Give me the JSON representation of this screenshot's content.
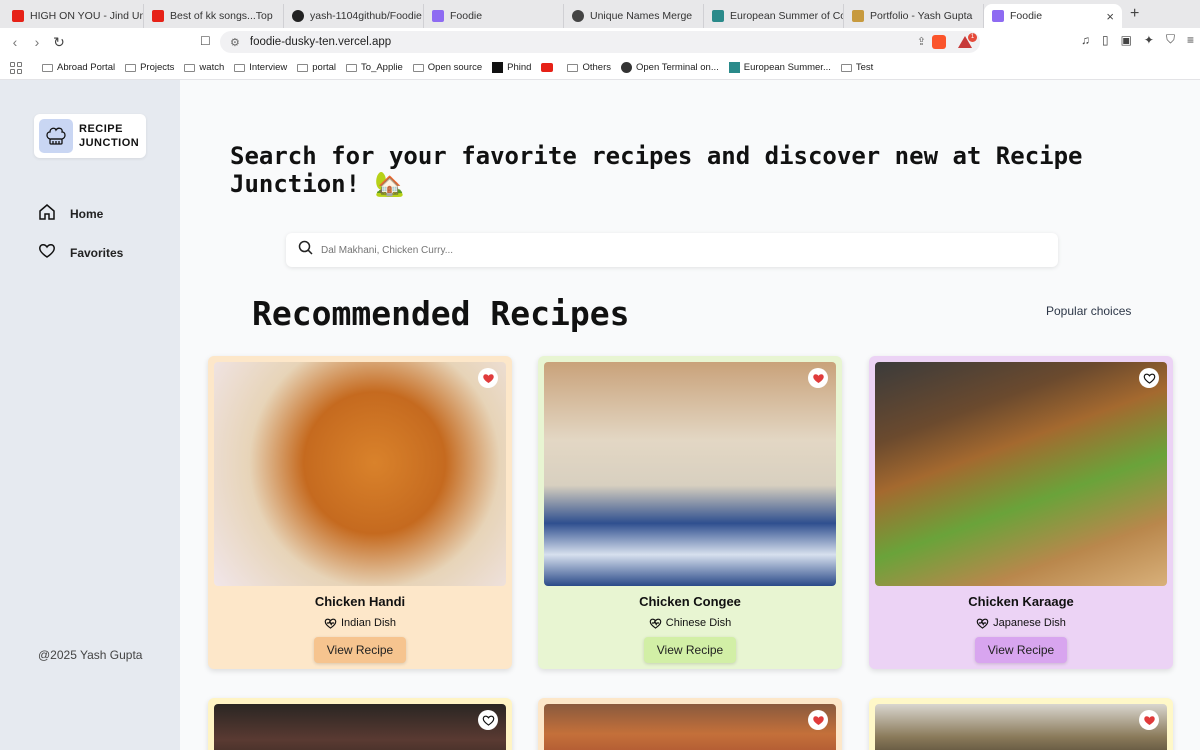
{
  "browser": {
    "tabs": [
      {
        "label": "HIGH ON YOU - Jind Unive",
        "color": "#e62117"
      },
      {
        "label": "Best of kk songs...Top",
        "color": "#e62117"
      },
      {
        "label": "yash-1104github/Foodie",
        "color": "#222222"
      },
      {
        "label": "Foodie",
        "color": "#8e6bf2"
      },
      {
        "label": "Unique Names Merge",
        "color": "#444444"
      },
      {
        "label": "European Summer of Code",
        "color": "#2a8a8a"
      },
      {
        "label": "Portfolio - Yash Gupta",
        "color": "#c79a3e"
      },
      {
        "label": "Foodie",
        "color": "#8e6bf2"
      }
    ],
    "url": "foodie-dusky-ten.vercel.app",
    "badge_count": "1",
    "bookmarks": [
      "Abroad Portal",
      "Projects",
      "watch",
      "Interview",
      "portal",
      "To_Applie",
      "Open source",
      "Phind",
      "",
      "Others",
      "Open Terminal on...",
      "European Summer...",
      "Test"
    ]
  },
  "sidebar": {
    "logo_line1": "RECIPE",
    "logo_line2": "JUNCTION",
    "nav": [
      {
        "label": "Home",
        "icon": "home-icon"
      },
      {
        "label": "Favorites",
        "icon": "heart-icon"
      }
    ],
    "footer": "@2025 Yash Gupta"
  },
  "main": {
    "hero": "Search for your favorite recipes and discover new at Recipe Junction! 🏡",
    "search_placeholder": "Dal Makhani, Chicken Curry...",
    "section_title": "Recommended Recipes",
    "popular_label": "Popular choices",
    "view_label": "View Recipe",
    "cards": [
      {
        "title": "Chicken Handi",
        "cuisine": "Indian Dish",
        "favorited": true
      },
      {
        "title": "Chicken Congee",
        "cuisine": "Chinese Dish",
        "favorited": true
      },
      {
        "title": "Chicken Karaage",
        "cuisine": "Japanese Dish",
        "favorited": false
      }
    ],
    "partial_cards": [
      {
        "favorited": false
      },
      {
        "favorited": true
      },
      {
        "favorited": true
      }
    ]
  },
  "colors": {
    "card_bg": [
      "#fde7c9",
      "#e8f5d2",
      "#ecd3f5"
    ],
    "button_bg": [
      "#f6c48f",
      "#d2efa6",
      "#d8a5ef"
    ],
    "partial_bg": [
      "#fff4c4",
      "#fde7c9",
      "#fff8c8"
    ],
    "favorite_red": "#e03b3b"
  }
}
